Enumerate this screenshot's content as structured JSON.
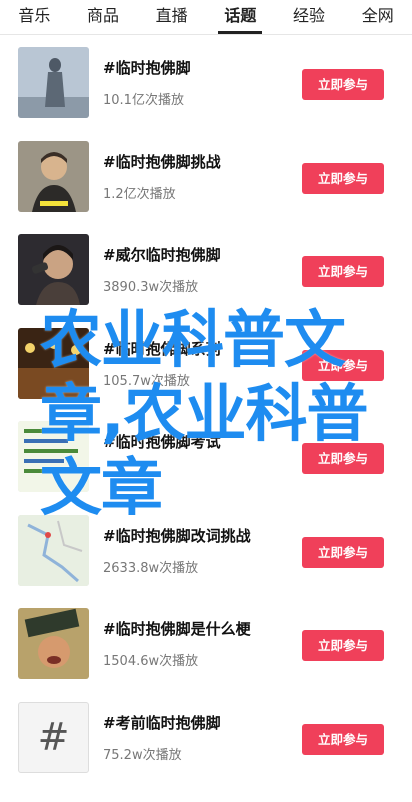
{
  "tabs": [
    "音乐",
    "商品",
    "直播",
    "话题",
    "经验",
    "全网"
  ],
  "active_tab": "话题",
  "join_label": "立即参与",
  "items": [
    {
      "title": "#临时抱佛脚",
      "plays": "10.1亿次播放",
      "thumb": "statue-photo"
    },
    {
      "title": "#临时抱佛脚挑战",
      "plays": "1.2亿次播放",
      "thumb": "person-photo"
    },
    {
      "title": "#威尔临时抱佛脚",
      "plays": "3890.3w次播放",
      "thumb": "singer-photo"
    },
    {
      "title": "#临时抱佛脚系列",
      "plays": "105.7w次播放",
      "thumb": "stage-photo"
    },
    {
      "title": "#临时抱佛脚考试",
      "plays": "",
      "thumb": "notes-photo"
    },
    {
      "title": "#临时抱佛脚改词挑战",
      "plays": "2633.8w次播放",
      "thumb": "map-photo"
    },
    {
      "title": "#临时抱佛脚是什么梗",
      "plays": "1504.6w次播放",
      "thumb": "meme-photo"
    },
    {
      "title": "#考前临时抱佛脚",
      "plays": "75.2w次播放",
      "thumb": "hash-icon"
    }
  ],
  "overlay_text": "农业科普文章,农业科普文章",
  "colors": {
    "accent": "#f0405a",
    "overlay": "#1e8cf0"
  }
}
